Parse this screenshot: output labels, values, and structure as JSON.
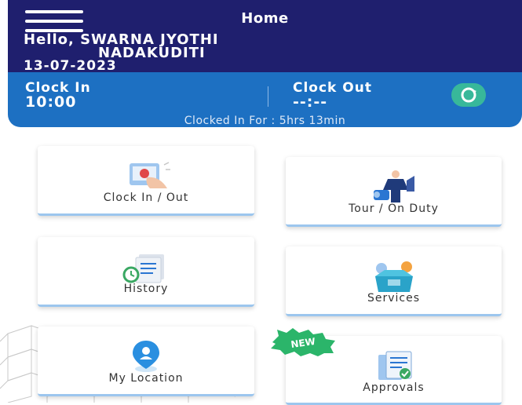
{
  "header": {
    "title": "Home",
    "greeting_line1": "Hello, SWARNA JYOTHI",
    "greeting_line2": "NADAKUDITI",
    "date": "13-07-2023"
  },
  "clock": {
    "in_label": "Clock In",
    "in_value": "10:00",
    "out_label": "Clock Out",
    "out_value": "--:--",
    "duration": "Clocked In For : 5hrs 13min"
  },
  "tiles": [
    {
      "label": "Clock In / Out",
      "icon": "clock-in-out-icon"
    },
    {
      "label": "Tour / On Duty",
      "icon": "tour-duty-icon"
    },
    {
      "label": "History",
      "icon": "history-icon"
    },
    {
      "label": "Services",
      "icon": "services-icon"
    },
    {
      "label": "My Location",
      "icon": "location-pin-icon"
    },
    {
      "label": "Approvals",
      "icon": "approvals-icon"
    }
  ],
  "badge": {
    "label": "NEW"
  },
  "colors": {
    "header_bg": "#1f1f6e",
    "clock_bg": "#1d70c2",
    "sync_btn": "#38b89a",
    "badge": "#2bb56a"
  }
}
